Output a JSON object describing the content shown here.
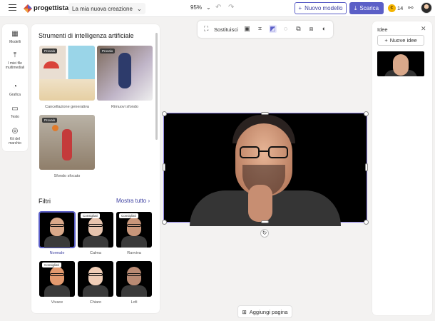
{
  "header": {
    "brand": "progettista",
    "doc_name": "La mia nuova creazione",
    "zoom": "95%",
    "new_template": "Nuovo modello",
    "download": "Scarica",
    "coins": "14"
  },
  "rail": {
    "items": [
      {
        "label": "Modelli"
      },
      {
        "label": "I miei file multimediali"
      },
      {
        "label": "Grafica"
      },
      {
        "label": "Testo"
      },
      {
        "label": "Kit del marchio"
      }
    ]
  },
  "panel": {
    "title": "Strumenti di intelligenza artificiale",
    "tools": [
      {
        "label": "Cancellazione generativa",
        "badge": "Provalo"
      },
      {
        "label": "Rimuovi sfondo",
        "badge": "Provalo"
      },
      {
        "label": "Sfondo sfocato",
        "badge": "Provalo"
      }
    ],
    "filters_title": "Filtri",
    "show_all": "Mostra tutto",
    "filters": [
      {
        "label": "Normale",
        "badge": "",
        "selected": true
      },
      {
        "label": "Calma",
        "badge": "Consigliati"
      },
      {
        "label": "Ravviva",
        "badge": "Consigliati"
      },
      {
        "label": "Vivace",
        "badge": "Consigliati"
      },
      {
        "label": "Chiaro",
        "badge": ""
      },
      {
        "label": "Lofi",
        "badge": ""
      }
    ]
  },
  "toolbar": {
    "replace": "Sostituisci"
  },
  "canvas": {
    "add_page": "Aggiungi pagina"
  },
  "ideas": {
    "title": "Idee",
    "new_ideas": "Nuove idee"
  },
  "colors": {
    "accent": "#5b5fc7",
    "coin": "#f4b400"
  }
}
